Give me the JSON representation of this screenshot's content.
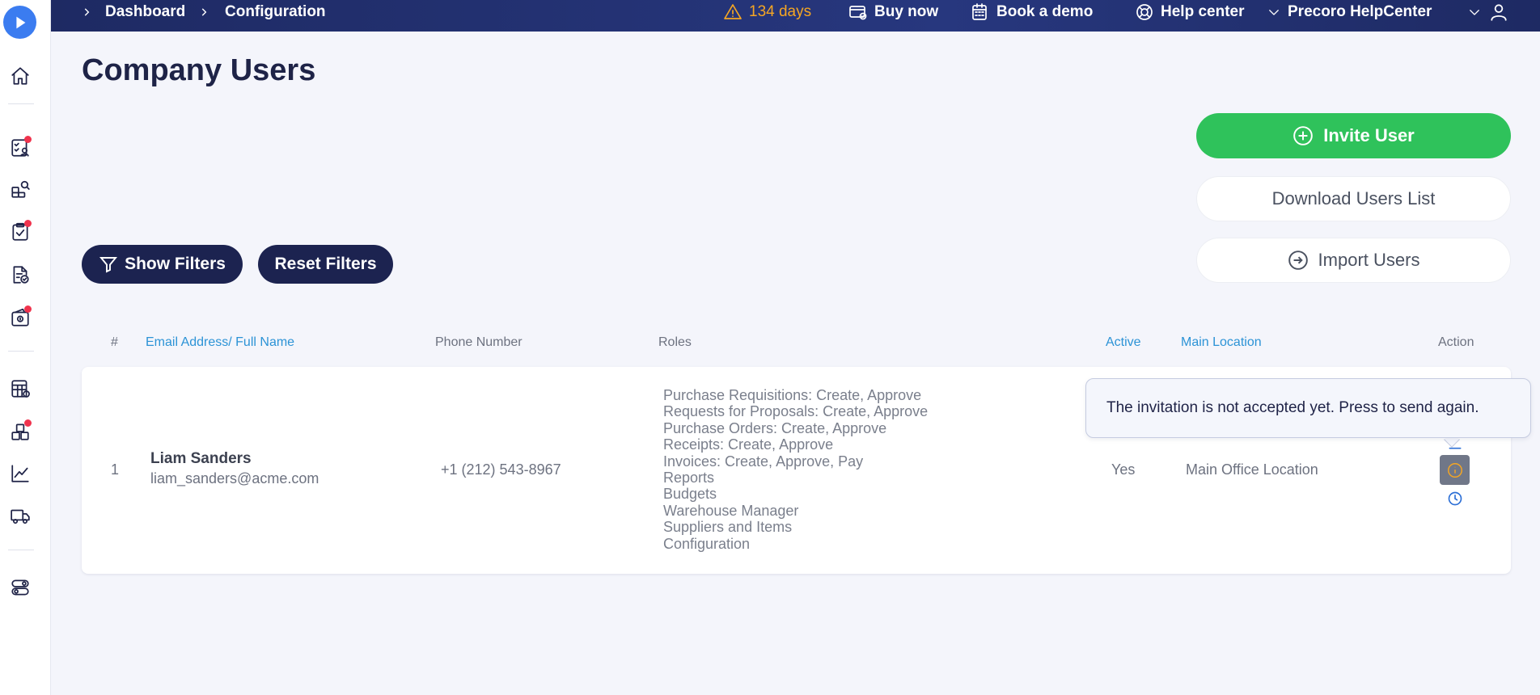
{
  "topbar": {
    "breadcrumbs": [
      {
        "label": "Dashboard"
      },
      {
        "label": "Configuration"
      }
    ],
    "trial": {
      "label": "134 days",
      "icon": "warning-icon",
      "color": "#f5a623"
    },
    "buy_now": {
      "label": "Buy now",
      "icon": "credit-card-icon"
    },
    "book_demo": {
      "label": "Book a demo",
      "icon": "calendar-icon"
    },
    "help_center": {
      "label": "Help center",
      "icon": "lifebuoy-icon"
    },
    "company": {
      "label": "Precoro HelpCenter",
      "icon": "chevron-down-icon"
    },
    "user_menu": {
      "icon": "user-icon"
    }
  },
  "sidebar": {
    "items": [
      {
        "name": "home",
        "icon": "home-icon"
      },
      {
        "name": "purchase-requisitions",
        "icon": "checklist-user-icon",
        "badge": true
      },
      {
        "name": "requests-for-proposals",
        "icon": "boxes-search-icon",
        "badge": false
      },
      {
        "name": "purchase-orders",
        "icon": "clipboard-check-icon",
        "badge": true
      },
      {
        "name": "receipts",
        "icon": "document-check-icon",
        "badge": false
      },
      {
        "name": "invoices",
        "icon": "wallet-icon",
        "badge": true
      },
      {
        "name": "budgets",
        "icon": "table-icon",
        "badge": false
      },
      {
        "name": "warehouse",
        "icon": "blocks-icon",
        "badge": true
      },
      {
        "name": "reports",
        "icon": "chart-line-icon",
        "badge": false
      },
      {
        "name": "suppliers",
        "icon": "truck-icon",
        "badge": false
      },
      {
        "name": "configuration",
        "icon": "toggles-icon",
        "badge": false
      }
    ]
  },
  "page": {
    "title": "Company Users"
  },
  "actions": {
    "invite_user": "Invite User",
    "download_list": "Download Users List",
    "import_users": "Import Users"
  },
  "filters": {
    "show_filters": "Show Filters",
    "reset_filters": "Reset Filters"
  },
  "table": {
    "columns": {
      "index": "#",
      "email_name": "Email Address/ Full Name",
      "phone": "Phone Number",
      "roles": "Roles",
      "active": "Active",
      "main_location": "Main Location",
      "action": "Action"
    },
    "rows": [
      {
        "index": "1",
        "full_name": "Liam Sanders",
        "email": "liam_sanders@acme.com",
        "phone": "+1 (212) 543-8967",
        "roles": [
          "Purchase Requisitions: Create, Approve",
          "Requests for Proposals: Create, Approve",
          "Purchase Orders: Create, Approve",
          "Receipts: Create, Approve",
          "Invoices: Create, Approve, Pay",
          "Reports",
          "Budgets",
          "Warehouse Manager",
          "Suppliers and Items",
          "Configuration"
        ],
        "active": "Yes",
        "main_location": "Main Office Location"
      }
    ]
  },
  "tooltip": {
    "text": "The invitation is not accepted yet. Press to send again."
  },
  "colors": {
    "primary_green": "#2fc25b",
    "navy": "#1c2350",
    "link_blue": "#2c93d6",
    "badge_red": "#f0334d"
  }
}
